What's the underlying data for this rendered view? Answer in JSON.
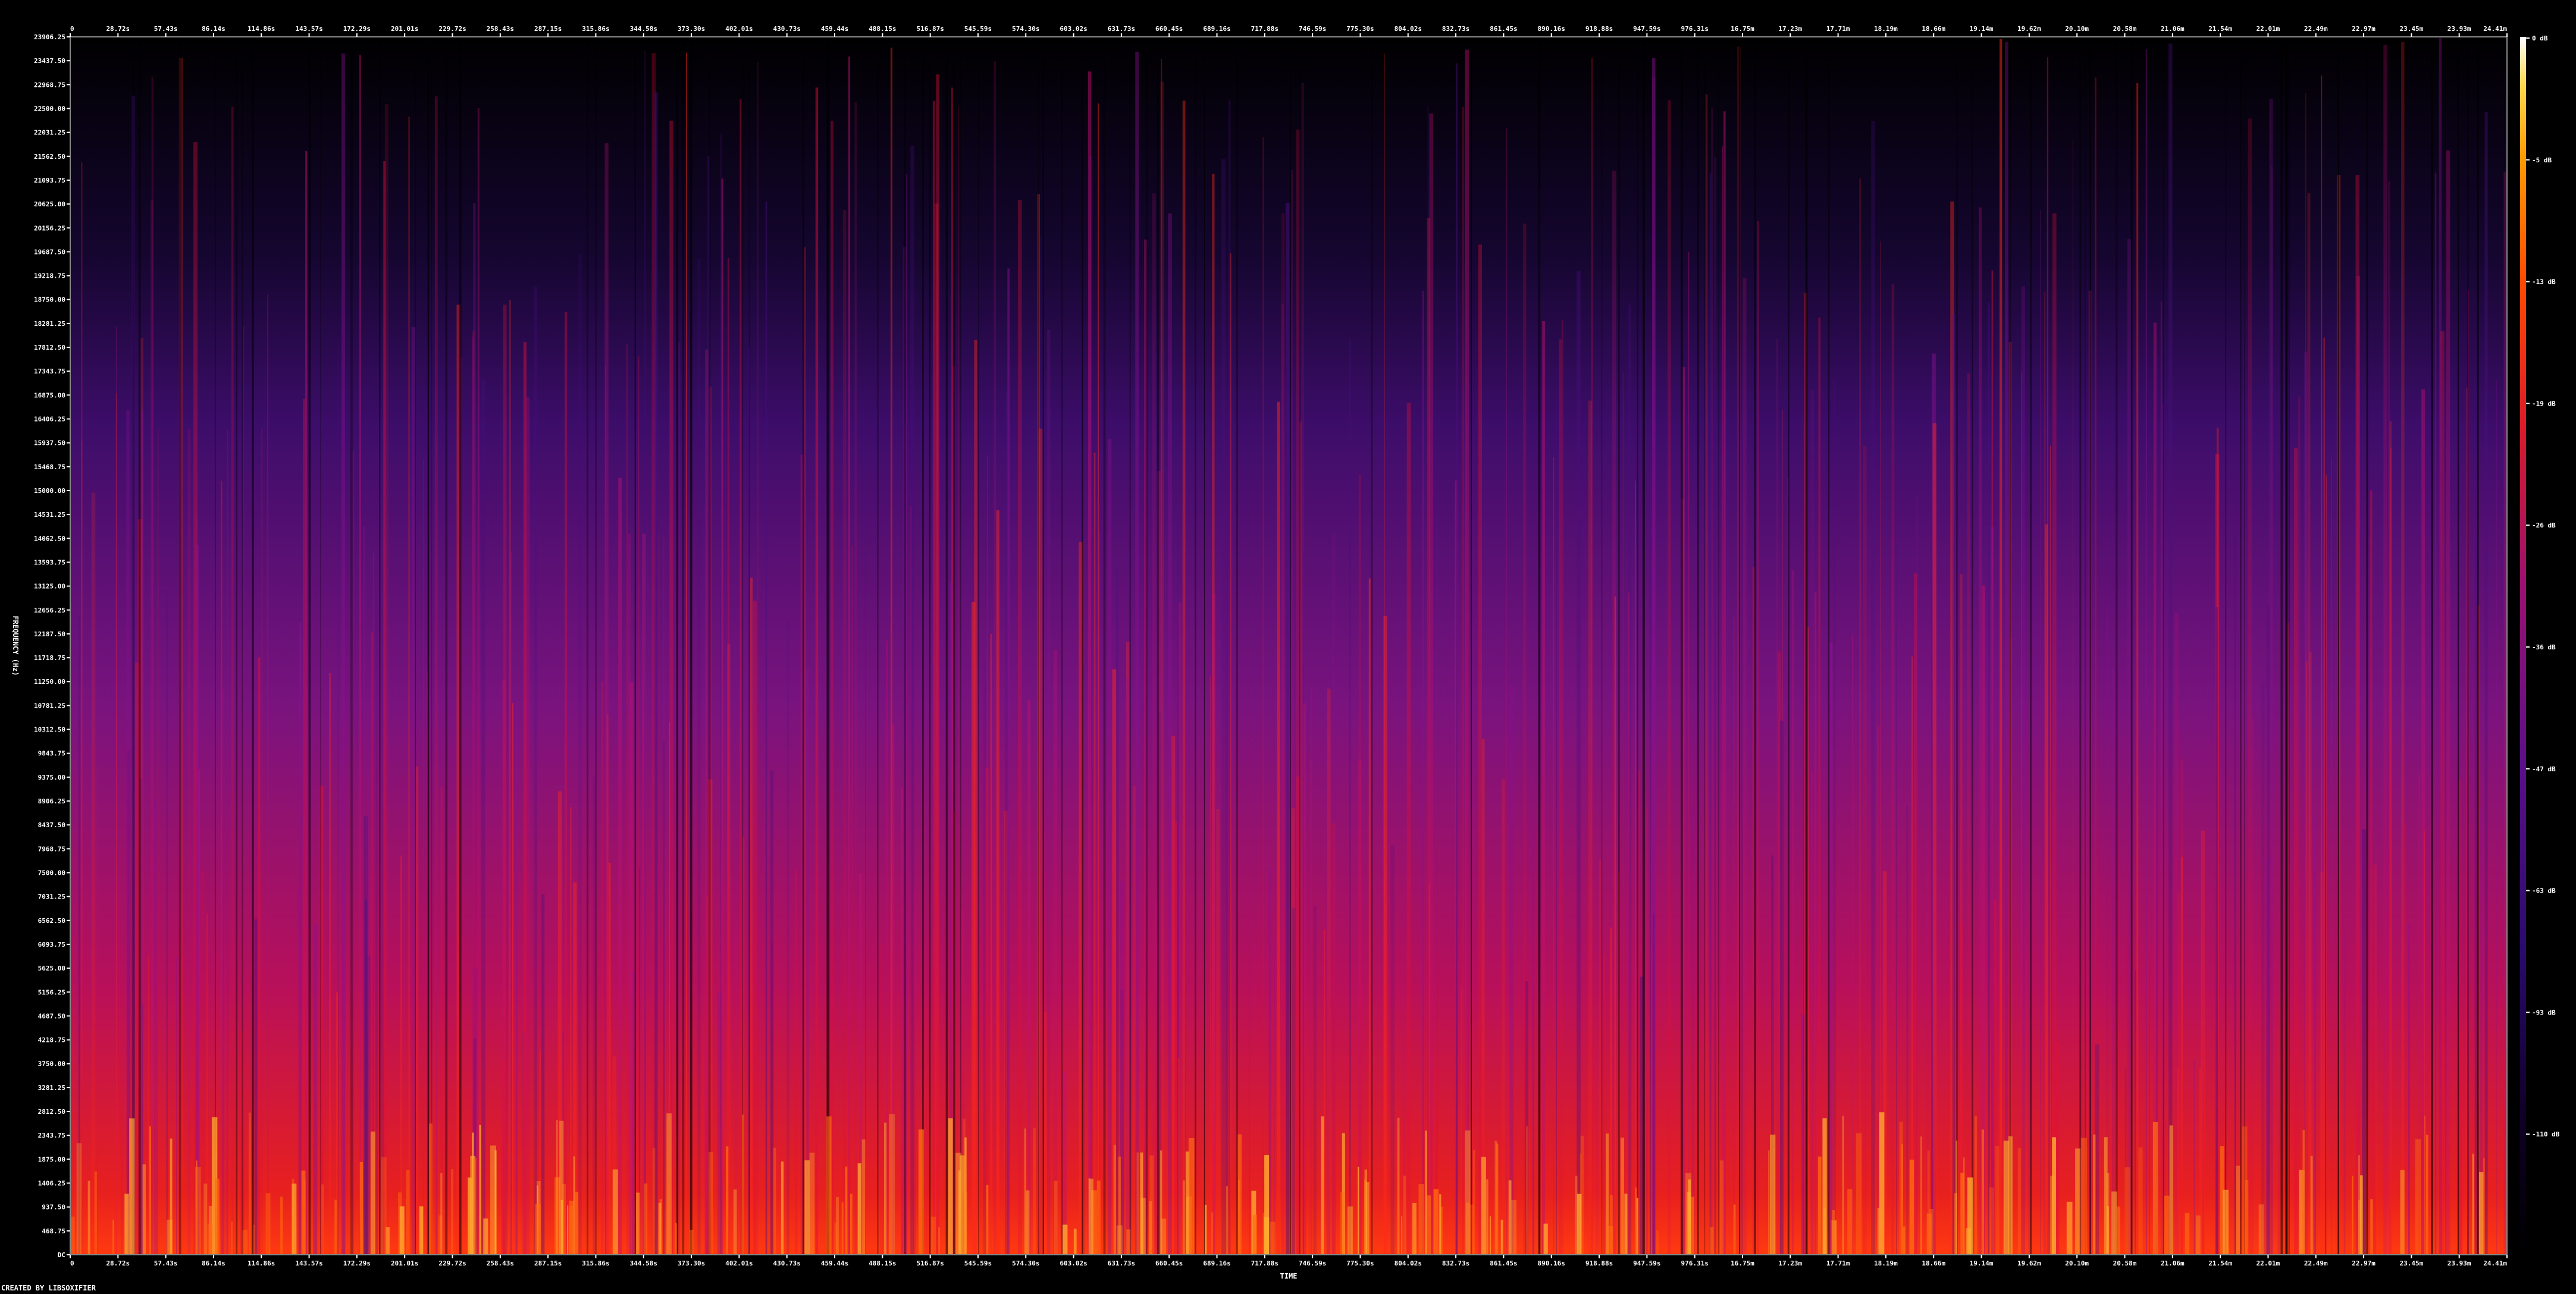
{
  "chart_data": {
    "type": "heatmap",
    "title": "",
    "xlabel": "TIME",
    "ylabel": "FREQUENCY (Hz)",
    "footer": "CREATED BY LIBSOXIFIER",
    "x_ticks": [
      "0",
      "28.72s",
      "57.43s",
      "86.14s",
      "114.86s",
      "143.57s",
      "172.29s",
      "201.01s",
      "229.72s",
      "258.43s",
      "287.15s",
      "315.86s",
      "344.58s",
      "373.30s",
      "402.01s",
      "430.73s",
      "459.44s",
      "488.15s",
      "516.87s",
      "545.59s",
      "574.30s",
      "603.02s",
      "631.73s",
      "660.45s",
      "689.16s",
      "717.88s",
      "746.59s",
      "775.30s",
      "804.02s",
      "832.73s",
      "861.45s",
      "890.16s",
      "918.88s",
      "947.59s",
      "976.31s",
      "16.75m",
      "17.23m",
      "17.71m",
      "18.19m",
      "18.66m",
      "19.14m",
      "19.62m",
      "20.10m",
      "20.58m",
      "21.06m",
      "21.54m",
      "22.01m",
      "22.49m",
      "22.97m",
      "23.45m",
      "23.93m",
      "24.41m"
    ],
    "y_ticks": [
      "23906.25",
      "23437.50",
      "22968.75",
      "22500.00",
      "22031.25",
      "21562.50",
      "21093.75",
      "20625.00",
      "20156.25",
      "19687.50",
      "19218.75",
      "18750.00",
      "18281.25",
      "17812.50",
      "17343.75",
      "16875.00",
      "16406.25",
      "15937.50",
      "15468.75",
      "15000.00",
      "14531.25",
      "14062.50",
      "13593.75",
      "13125.00",
      "12656.25",
      "12187.50",
      "11718.75",
      "11250.00",
      "10781.25",
      "10312.50",
      "9843.75",
      "9375.00",
      "8906.25",
      "8437.50",
      "7968.75",
      "7500.00",
      "7031.25",
      "6562.50",
      "6093.75",
      "5625.00",
      "5156.25",
      "4687.50",
      "4218.75",
      "3750.00",
      "3281.25",
      "2812.50",
      "2343.75",
      "1875.00",
      "1406.25",
      "937.50",
      "468.75",
      "DC"
    ],
    "colorbar": {
      "ticks": [
        "0 dB",
        "-5 dB",
        "-13 dB",
        "-19 dB",
        "-26 dB",
        "-36 dB",
        "-47 dB",
        "-63 dB",
        "-93 dB",
        "-110 dB"
      ],
      "colors": [
        "#000000",
        "#10002a",
        "#2a0a6e",
        "#5a0f8a",
        "#9a1070",
        "#d81b2a",
        "#ff4a00",
        "#ff9a00",
        "#ffd84a",
        "#ffffff"
      ]
    },
    "grid": false,
    "legend": "right colorbar"
  }
}
